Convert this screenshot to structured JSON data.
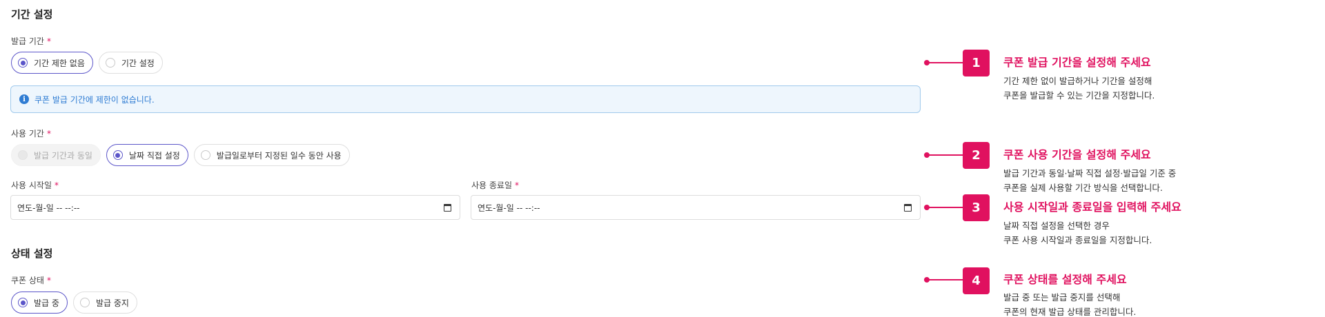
{
  "period_section": {
    "title": "기간 설정",
    "issue_period": {
      "label": "발급 기간",
      "required": "*",
      "options": [
        {
          "label": "기간 제한 없음",
          "selected": true
        },
        {
          "label": "기간 설정",
          "selected": false
        }
      ],
      "info": "쿠폰 발급 기간에 제한이 없습니다."
    },
    "use_period": {
      "label": "사용 기간",
      "required": "*",
      "options": [
        {
          "label": "발급 기간과 동일",
          "disabled": true
        },
        {
          "label": "날짜 직접 설정",
          "selected": true
        },
        {
          "label": "발급일로부터 지정된 일수 동안 사용",
          "selected": false
        }
      ]
    },
    "start_date": {
      "label": "사용 시작일",
      "required": "*",
      "value": "연도-월-일 -- --:--"
    },
    "end_date": {
      "label": "사용 종료일",
      "required": "*",
      "value": "연도-월-일 -- --:--"
    }
  },
  "status_section": {
    "title": "상태 설정",
    "coupon_status": {
      "label": "쿠폰 상태",
      "required": "*",
      "options": [
        {
          "label": "발급 중",
          "selected": true
        },
        {
          "label": "발급 중지",
          "selected": false
        }
      ]
    }
  },
  "callouts": [
    {
      "number": "1",
      "title": "쿠폰 발급 기간을 설정해 주세요",
      "lines": [
        "기간 제한 없이 발급하거나 기간을 설정해",
        "쿠폰을 발급할 수 있는 기간을 지정합니다."
      ]
    },
    {
      "number": "2",
      "title": "쿠폰 사용 기간을 설정해 주세요",
      "lines": [
        "발급 기간과 동일·날짜 직접 설정·발급일 기준 중",
        "쿠폰을 실제 사용할 기간 방식을 선택합니다."
      ]
    },
    {
      "number": "3",
      "title": "사용 시작일과 종료일을 입력해 주세요",
      "lines": [
        "날짜 직접 설정을 선택한 경우",
        "쿠폰 사용 시작일과 종료일을 지정합니다."
      ]
    },
    {
      "number": "4",
      "title": "쿠폰 상태를 설정해 주세요",
      "lines": [
        "발급 중 또는 발급 중지를 선택해",
        "쿠폰의 현재 발급 상태를 관리합니다."
      ]
    }
  ],
  "colors": {
    "accent": "#e0115f",
    "radio": "#5b55c9",
    "info": "#2f7cd3"
  }
}
